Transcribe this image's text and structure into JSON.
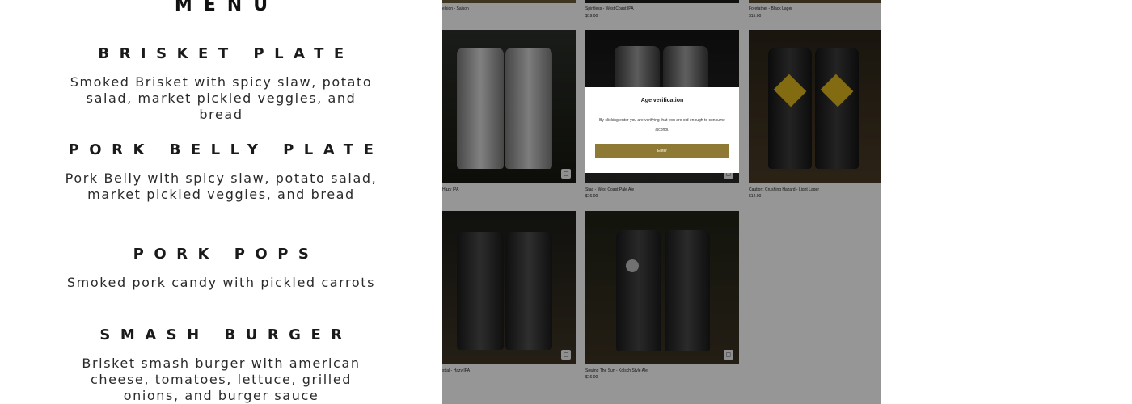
{
  "menu": {
    "title": "MENU",
    "items": [
      {
        "name": "BRISKET PLATE",
        "description": "Smoked Brisket with spicy slaw, potato salad, market pickled veggies, and bread"
      },
      {
        "name": "PORK BELLY PLATE",
        "description": "Pork Belly with spicy slaw, potato salad, market pickled veggies, and bread"
      },
      {
        "name": "PORK POPS",
        "description": "Smoked pork candy with pickled carrots"
      },
      {
        "name": "SMASH BURGER",
        "description": "Brisket smash burger with american cheese, tomatoes, lettuce, grilled onions, and burger sauce"
      }
    ]
  },
  "store": {
    "top_row": [
      {
        "name": "elsion - Saison",
        "price": ""
      },
      {
        "name": "Spiritless - West Coast IPA",
        "price": "$19.00"
      },
      {
        "name": "Forefather - Black Lager",
        "price": "$15.00"
      }
    ],
    "products": [
      {
        "name": "Hazy IPA",
        "price": ""
      },
      {
        "name": "Stag - West Coast Pale Ale",
        "price": "$16.00"
      },
      {
        "name": "Caution: Crushing Hazard - Light Lager",
        "price": "$14.00"
      },
      {
        "name": "sttal - Hazy IPA",
        "price": ""
      },
      {
        "name": "Sowing The Sun - Kolsch Style Ale",
        "price": "$16.00"
      }
    ],
    "favorite_icon": "bag-icon"
  },
  "modal": {
    "title": "Age verification",
    "text": "By clicking enter you are verifying that you are old enough to consume alcohol.",
    "button_label": "Enter",
    "accent_color": "#8f7a35"
  }
}
